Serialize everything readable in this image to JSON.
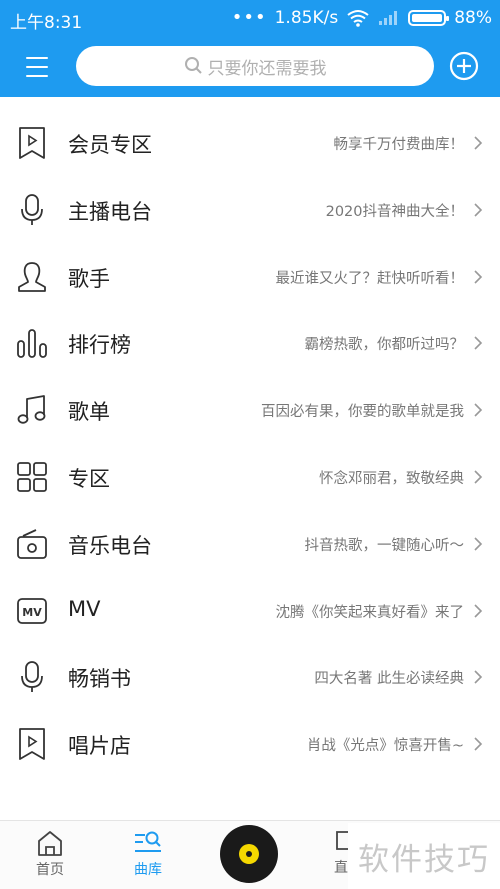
{
  "status_bar": {
    "time": "上午8:31",
    "dots": "•••",
    "speed": "1.85K/s",
    "battery": "88%"
  },
  "header": {
    "search_placeholder": "只要你还需要我",
    "accent_color": "#1e9bf0"
  },
  "list": {
    "items": [
      {
        "title": "会员专区",
        "desc": "畅享千万付费曲库！",
        "icon": "play-bookmark-icon"
      },
      {
        "title": "主播电台",
        "desc": "2020抖音神曲大全！",
        "icon": "microphone-icon"
      },
      {
        "title": "歌手",
        "desc": "最近谁又火了？赶快听听看！",
        "icon": "singer-icon"
      },
      {
        "title": "排行榜",
        "desc": "霸榜热歌，你都听过吗？",
        "icon": "bar-chart-icon"
      },
      {
        "title": "歌单",
        "desc": "百因必有果，你要的歌单就是我",
        "icon": "music-note-icon"
      },
      {
        "title": "专区",
        "desc": "怀念邓丽君，致敬经典",
        "icon": "grid-icon"
      },
      {
        "title": "音乐电台",
        "desc": "抖音热歌，一键随心听～",
        "icon": "radio-icon"
      },
      {
        "title": "MV",
        "desc": "沈腾《你笑起来真好看》来了",
        "icon": "mv-icon"
      },
      {
        "title": "畅销书",
        "desc": "四大名著 此生必读经典",
        "icon": "microphone-icon"
      },
      {
        "title": "唱片店",
        "desc": "肖战《光点》惊喜开售~",
        "icon": "play-bookmark-icon"
      }
    ]
  },
  "bottom_nav": {
    "home_label": "首页",
    "library_label": "曲库",
    "partial_label": "直",
    "watermark": "软件技巧"
  }
}
